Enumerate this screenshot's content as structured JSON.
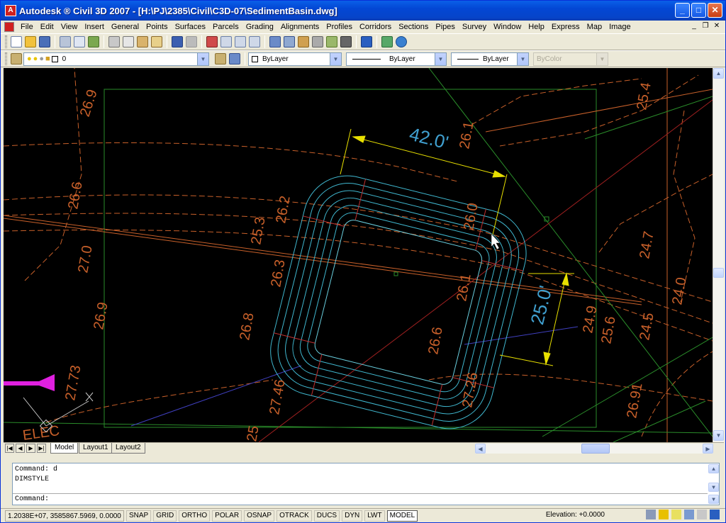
{
  "window": {
    "title": "Autodesk ® Civil 3D 2007 - [H:\\PJ\\2385\\Civil\\C3D-07\\SedimentBasin.dwg]",
    "minimize": "_",
    "maximize": "□",
    "close": "✕"
  },
  "menu": [
    "File",
    "Edit",
    "View",
    "Insert",
    "General",
    "Points",
    "Surfaces",
    "Parcels",
    "Grading",
    "Alignments",
    "Profiles",
    "Corridors",
    "Sections",
    "Pipes",
    "Survey",
    "Window",
    "Help",
    "Express",
    "Map",
    "Image"
  ],
  "layer_combo": {
    "value": "0"
  },
  "color_combo": {
    "value": "ByLayer"
  },
  "linetype_combo": {
    "value": "ByLayer"
  },
  "lineweight_combo": {
    "value": "ByLayer"
  },
  "plotstyle_combo": {
    "value": "ByColor"
  },
  "drawing": {
    "dim_top": "42.0'",
    "dim_right": "25.0'",
    "labels": [
      "26.9",
      "26.6",
      "26.2",
      "26.1",
      "25.4",
      "25.3",
      "27.0",
      "26.3",
      "26.0",
      "24.7",
      "24.0",
      "26.9",
      "26.8",
      "26.6",
      "26.1",
      "25.6",
      "24.9",
      "24.5",
      "27.73",
      "27.46",
      "27.26",
      "26.91",
      "25",
      "ELEC"
    ]
  },
  "tabs": {
    "model": "Model",
    "layout1": "Layout1",
    "layout2": "Layout2"
  },
  "command": {
    "line1": "Command: d",
    "line2": "DIMSTYLE",
    "prompt": "Command:"
  },
  "status": {
    "coords": "1.2038E+07, 3585867.5969, 0.0000",
    "buttons": [
      "SNAP",
      "GRID",
      "ORTHO",
      "POLAR",
      "OSNAP",
      "OTRACK",
      "DUCS",
      "DYN",
      "LWT"
    ],
    "model": "MODEL",
    "elevation": "Elevation:  +0.0000"
  }
}
